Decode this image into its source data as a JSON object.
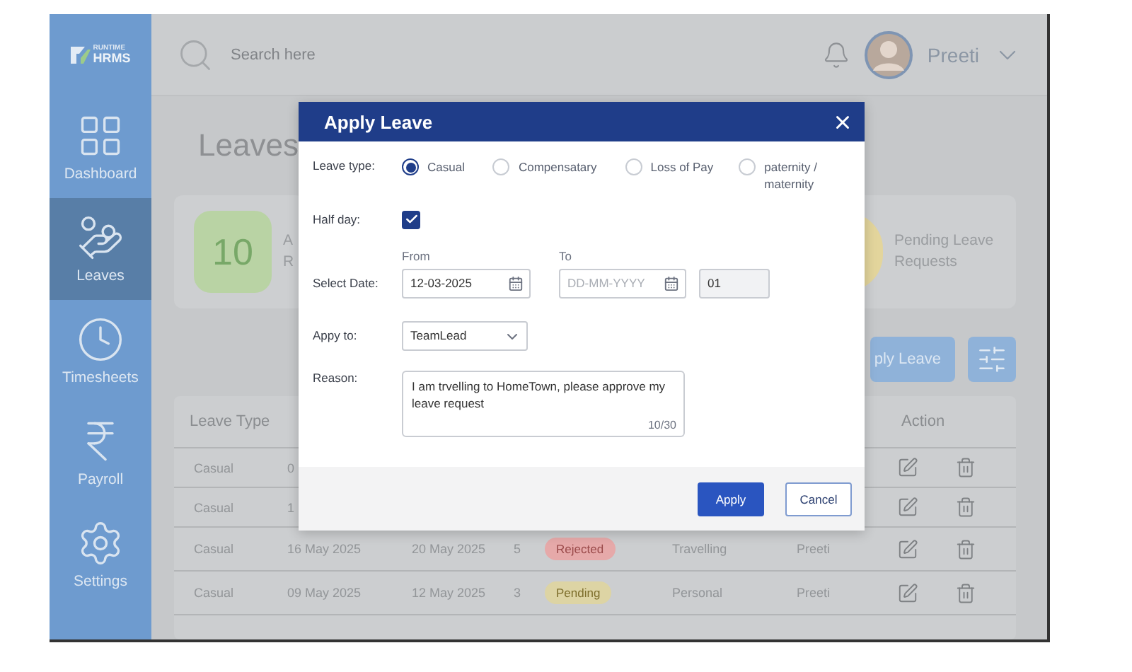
{
  "sidebar": {
    "logo": {
      "top": "RUNTIME",
      "bottom": "HRMS"
    },
    "items": [
      {
        "label": "Dashboard",
        "selected": false
      },
      {
        "label": "Leaves",
        "selected": true
      },
      {
        "label": "Timesheets",
        "selected": false
      },
      {
        "label": "Payroll",
        "selected": false
      },
      {
        "label": "Settings",
        "selected": false
      }
    ]
  },
  "topbar": {
    "search": {
      "placeholder": "Search here"
    },
    "user": {
      "name": "Preeti"
    }
  },
  "page": {
    "title": "Leaves",
    "stats": [
      {
        "value": "10",
        "lines": [
          "A",
          "R"
        ],
        "color": "#b9d3a4"
      },
      {
        "lines": [
          "Pending Leave",
          "Requests"
        ],
        "color": "#e3d59c"
      }
    ],
    "apply_button": "ply Leave",
    "table": {
      "columns": [
        "Leave Type",
        "Action"
      ],
      "rows": [
        {
          "leave_type": "Casual",
          "from": "0"
        },
        {
          "leave_type": "Casual",
          "from": "1"
        },
        {
          "leave_type": "Casual",
          "from": "16 May 2025",
          "to": "20 May 2025",
          "days": "5",
          "status": {
            "label": "Rejected",
            "kind": "rejected"
          },
          "reason": "Travelling",
          "approver": "Preeti"
        },
        {
          "leave_type": "Casual",
          "from": "09 May 2025",
          "to": "12 May 2025",
          "days": "3",
          "status": {
            "label": "Pending",
            "kind": "pending"
          },
          "reason": "Personal",
          "approver": "Preeti"
        }
      ]
    }
  },
  "dialog": {
    "title": "Apply Leave",
    "leave_type": {
      "label": "Leave type:",
      "options": [
        {
          "label": "Casual",
          "selected": true
        },
        {
          "label": "Compensatary",
          "selected": false
        },
        {
          "label": "Loss of Pay",
          "selected": false
        },
        {
          "label": "paternity / maternity",
          "selected": false
        }
      ]
    },
    "half_day": {
      "label": "Half day:",
      "checked": true
    },
    "date": {
      "label": "Select Date:",
      "from": {
        "label": "From",
        "value": "12-03-2025"
      },
      "to": {
        "label": "To",
        "placeholder": "DD-MM-YYYY"
      },
      "days": "01"
    },
    "apply_to": {
      "label": "Appy to:",
      "value": "TeamLead"
    },
    "reason": {
      "label": "Reason:",
      "value": "I am trvelling to HomeTown, please approve my leave request",
      "counter": "10/30"
    },
    "buttons": [
      {
        "label": "Apply",
        "kind": "primary"
      },
      {
        "label": "Cancel",
        "kind": "secondary"
      }
    ]
  }
}
